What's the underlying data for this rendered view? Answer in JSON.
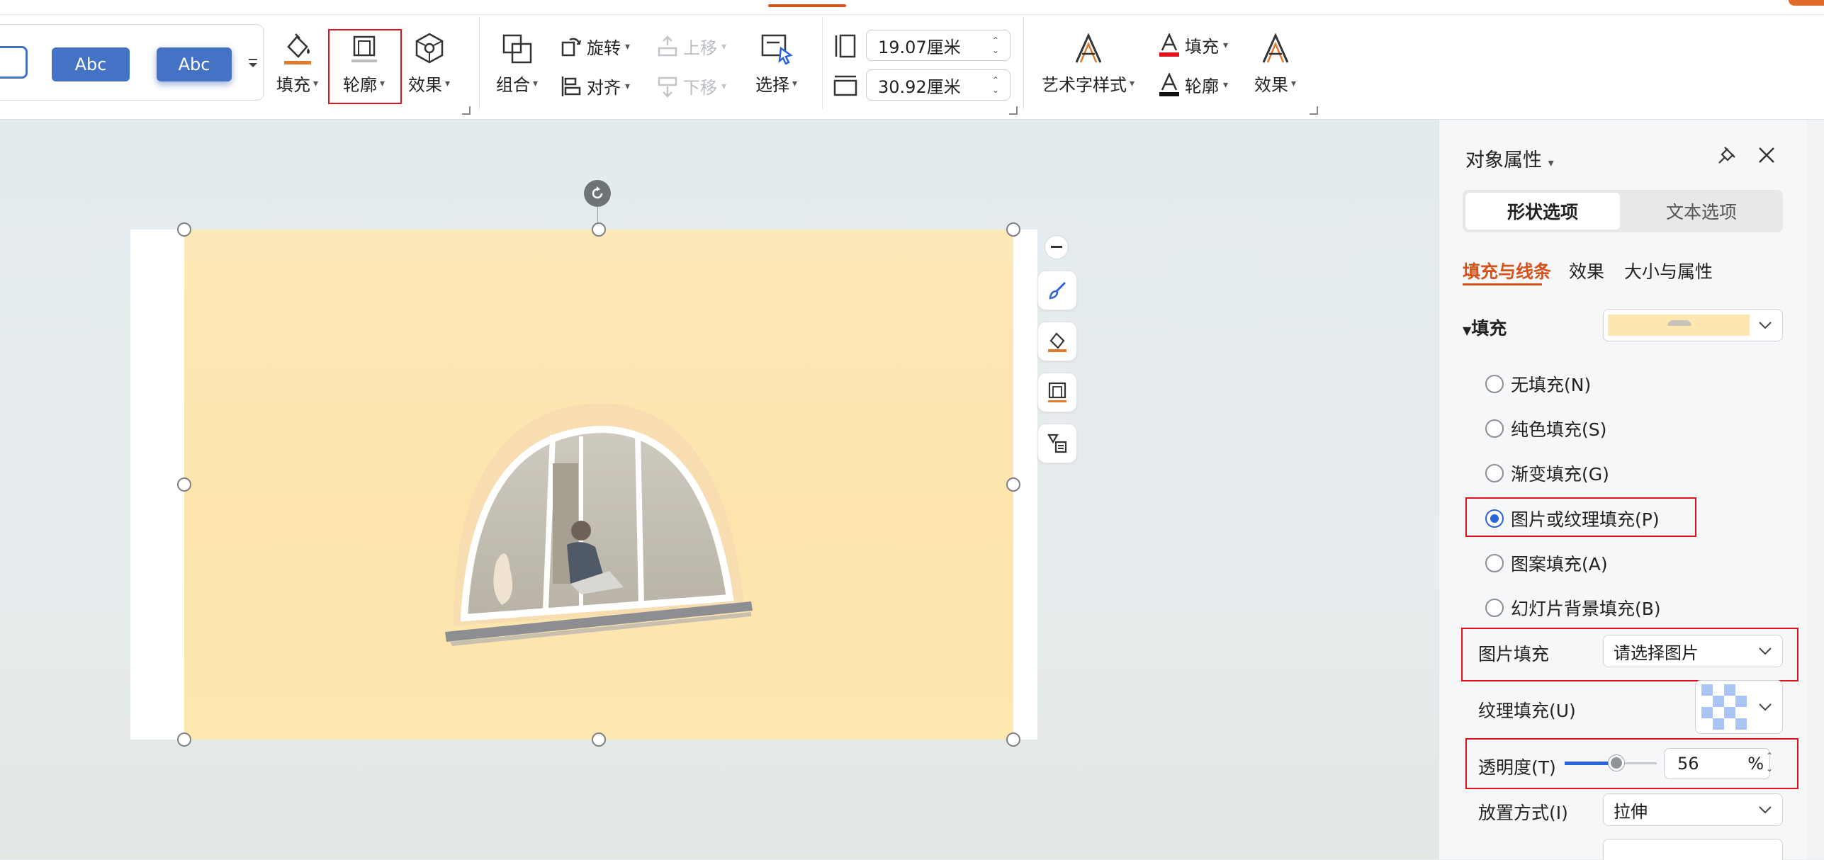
{
  "ribbon": {
    "styles": {
      "items": [
        "Abc",
        "Abc"
      ]
    },
    "fill_label": "填充",
    "outline_label": "轮廓",
    "effect_label": "效果",
    "group_label": "组合",
    "rotate_label": "旋转",
    "align_label": "对齐",
    "move_up_label": "上移",
    "move_down_label": "下移",
    "select_label": "选择",
    "height_value": "19.07厘米",
    "width_value": "30.92厘米",
    "wordart_label": "艺术字样式",
    "text_fill_label": "填充",
    "text_outline_label": "轮廓",
    "text_effect_label": "效果"
  },
  "panel": {
    "title": "对象属性",
    "tabs": [
      "形状选项",
      "文本选项"
    ],
    "subtabs": [
      "填充与线条",
      "效果",
      "大小与属性"
    ],
    "fill_section": "填充",
    "fill_options": [
      {
        "label": "无填充(N)",
        "selected": false
      },
      {
        "label": "纯色填充(S)",
        "selected": false
      },
      {
        "label": "渐变填充(G)",
        "selected": false
      },
      {
        "label": "图片或纹理填充(P)",
        "selected": true
      },
      {
        "label": "图案填充(A)",
        "selected": false
      },
      {
        "label": "幻灯片背景填充(B)",
        "selected": false
      }
    ],
    "picture_fill_label": "图片填充",
    "picture_fill_value": "请选择图片",
    "texture_fill_label": "纹理填充(U)",
    "transparency_label": "透明度(T)",
    "transparency_value": "56",
    "transparency_unit": "%",
    "transparency_fraction": 0.56,
    "placement_label": "放置方式(I)",
    "placement_value": "拉伸"
  },
  "colors": {
    "accent": "#d4531a",
    "highlight": "#e0121b",
    "abc_fill": "#4472c4",
    "picture_tint": "#fde6b0",
    "radio_selected": "#2b64d8"
  }
}
